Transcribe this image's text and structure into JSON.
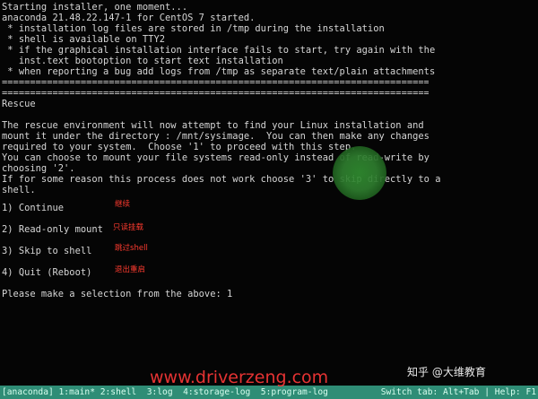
{
  "terminal": {
    "intro_lines": [
      "Starting installer, one moment...",
      "anaconda 21.48.22.147-1 for CentOS 7 started.",
      " * installation log files are stored in /tmp during the installation",
      " * shell is available on TTY2",
      " * if the graphical installation interface fails to start, try again with the",
      "   inst.text bootoption to start text installation",
      " * when reporting a bug add logs from /tmp as separate text/plain attachments"
    ],
    "separator": "================================================================================",
    "rescue_title": "Rescue",
    "rescue_text": [
      "The rescue environment will now attempt to find your Linux installation and",
      "mount it under the directory : /mnt/sysimage.  You can then make any changes",
      "required to your system.  Choose '1' to proceed with this step.",
      "You can choose to mount your file systems read-only instead of read-write by",
      "choosing '2'.",
      "If for some reason this process does not work choose '3' to skip directly to a",
      "shell."
    ],
    "menu": [
      {
        "label": "1) Continue",
        "annotation": "继续"
      },
      {
        "label": "2) Read-only mount",
        "annotation": "只读挂载"
      },
      {
        "label": "3) Skip to shell",
        "annotation": "跳过shell"
      },
      {
        "label": "4) Quit (Reboot)",
        "annotation": "退出重启"
      }
    ],
    "prompt": "Please make a selection from the above: 1"
  },
  "status_bar": {
    "left": "[anaconda] 1:main* 2:shell  3:log  4:storage-log  5:program-log",
    "right": "Switch tab: Alt+Tab | Help: F1"
  },
  "watermarks": {
    "url": "www.driverzeng.com",
    "logo": "知乎 @大维教育"
  },
  "colors": {
    "text": "#d6d6d6",
    "annotation": "#ff3b2f",
    "status_bar": "#2f8d76",
    "cursor_blob": "#2f8c2f"
  }
}
